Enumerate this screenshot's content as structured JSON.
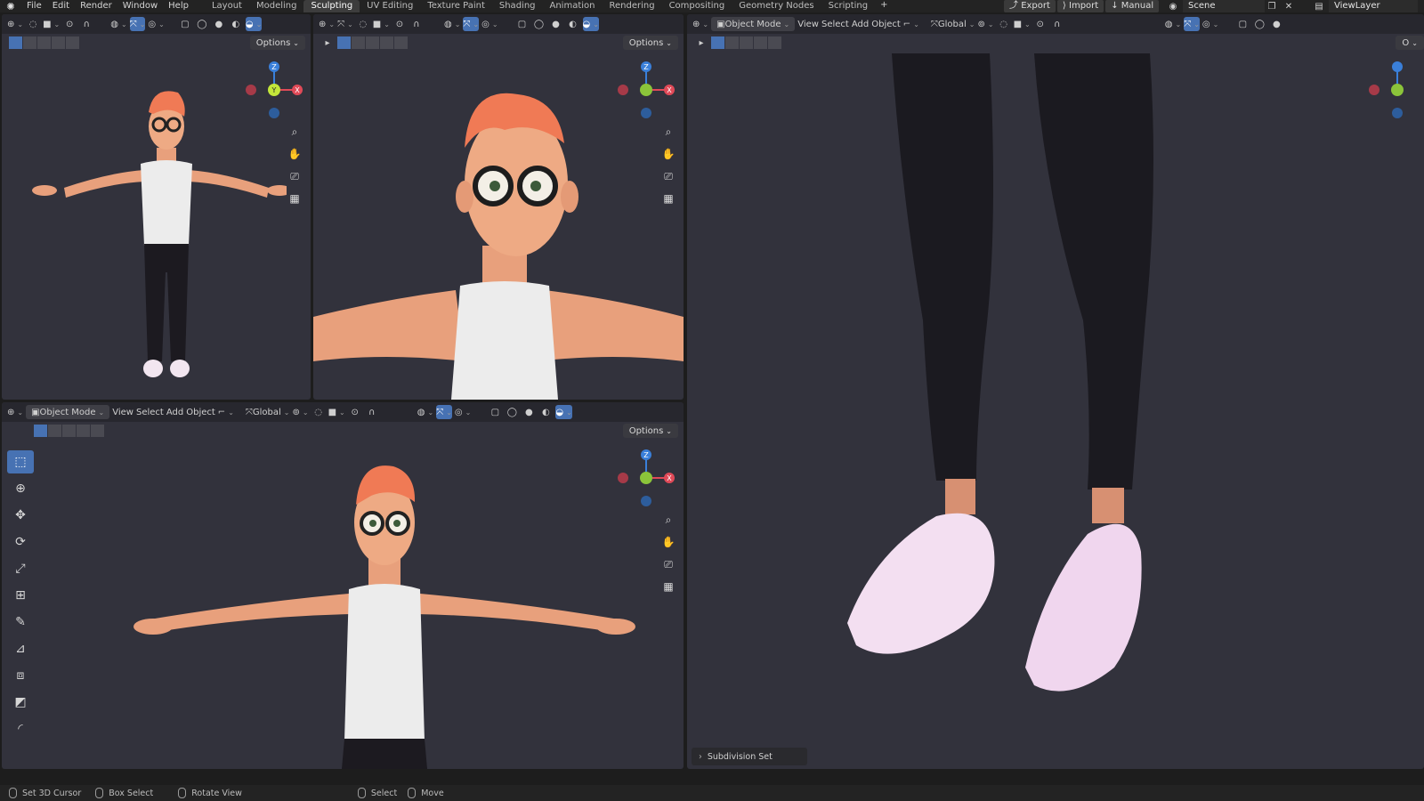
{
  "topbar": {
    "menus": [
      "File",
      "Edit",
      "Render",
      "Window",
      "Help"
    ],
    "workspaces": [
      "Layout",
      "Modeling",
      "Sculpting",
      "UV Editing",
      "Texture Paint",
      "Shading",
      "Animation",
      "Rendering",
      "Compositing",
      "Geometry Nodes",
      "Scripting"
    ],
    "active_workspace": "Sculpting",
    "add_symbol": "+",
    "export_label": "Export",
    "import_label": "Import",
    "manual_label": "Manual",
    "scene_name": "Scene",
    "view_layer_name": "ViewLayer"
  },
  "viewport_tl": {
    "options_label": "Options"
  },
  "viewport_tm": {
    "options_label": "Options"
  },
  "viewport_bl": {
    "mode_label": "Object Mode",
    "menus": [
      "View",
      "Select",
      "Add",
      "Object"
    ],
    "orientation_label": "Global",
    "options_label": "Options"
  },
  "viewport_right": {
    "mode_label": "Object Mode",
    "menus": [
      "View",
      "Select",
      "Add",
      "Object"
    ],
    "orientation_label": "Global",
    "options_label": "O",
    "last_operation_label": "Subdivision Set"
  },
  "gizmo_axes": {
    "z": "Z",
    "y": "Y",
    "x": "X"
  },
  "status": {
    "items": [
      "Set 3D Cursor",
      "Box Select",
      "Rotate View",
      "Select",
      "Move"
    ]
  },
  "colors": {
    "active_blue": "#4772b3",
    "axis_x": "#e04a58",
    "axis_y": "#8bc43a",
    "axis_z": "#3a7fd9",
    "viewport_bg": "#32323c"
  },
  "icons": {
    "nav": [
      "zoom-icon",
      "hand-pan-icon",
      "camera-icon",
      "grid-icon"
    ],
    "tools": [
      "select-box-icon",
      "cursor-icon",
      "move-icon",
      "rotate-icon",
      "scale-icon",
      "transform-icon",
      "annotate-icon",
      "measure-icon",
      "add-cube-icon",
      "extrude-icon",
      "bevel-icon"
    ]
  }
}
